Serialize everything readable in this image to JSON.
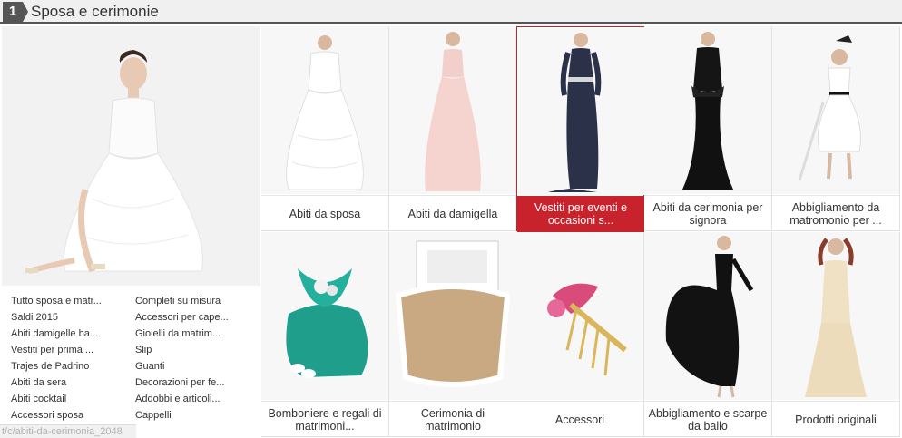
{
  "section": {
    "number": "1",
    "title": "Sposa e cerimonie"
  },
  "hero": {
    "image": "bride-in-white-wedding-dress"
  },
  "links_left": [
    "Tutto sposa e matr...",
    "Saldi 2015",
    "Abiti damigelle ba...",
    "Vestiti per prima ...",
    "Trajes de Padrino",
    "Abiti da sera",
    "Abiti cocktail",
    "Accessori sposa"
  ],
  "links_right": [
    "Completi su misura",
    "Accessori per cape...",
    "Gioielli da matrim...",
    "Slip",
    "Guanti",
    "Decorazioni per fe...",
    "Addobbi e articoli...",
    "Cappelli"
  ],
  "tiles": [
    {
      "label": "Abiti da sposa",
      "image": "white-wedding-gown"
    },
    {
      "label": "Abiti da damigella",
      "image": "pink-bridesmaid-dress"
    },
    {
      "label": "Vestiti per eventi e occasioni s...",
      "image": "navy-evening-gown",
      "active": true
    },
    {
      "label": "Abiti da cerimonia per signora",
      "image": "black-lace-mermaid-gown"
    },
    {
      "label": "Abbigliamento da matromonio per ...",
      "image": "flower-girl-white-dress"
    },
    {
      "label": "Bomboniere e regali di matrimoni...",
      "image": "teal-favor-pouch"
    },
    {
      "label": "Cerimonia di matrimonio",
      "image": "lace-burlap-frame"
    },
    {
      "label": "Accessori",
      "image": "pink-crystal-hair-comb"
    },
    {
      "label": "Abbigliamento e scarpe da ballo",
      "image": "black-ballroom-dress"
    },
    {
      "label": "Prodotti originali",
      "image": "champagne-lace-gown"
    }
  ],
  "status_bar": "t/c/abiti-da-cerimonia_2048",
  "colors": {
    "accent": "#c8232c",
    "header_bg": "#f0f0f0",
    "header_dark": "#555555"
  }
}
